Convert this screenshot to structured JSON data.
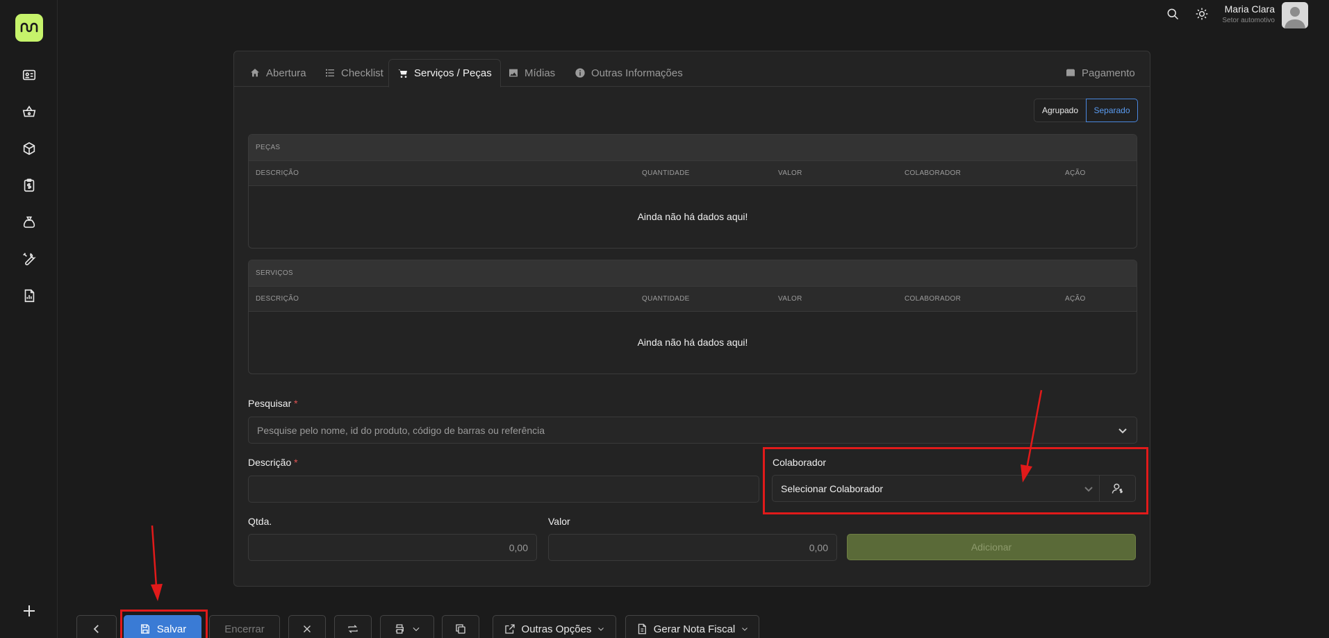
{
  "user": {
    "name": "Maria Clara",
    "role": "Setor automotivo"
  },
  "sidebar": {
    "icons": [
      "id-card-icon",
      "basket-icon",
      "box-icon",
      "clipboard-dollar-icon",
      "money-bag-icon",
      "wrench-icon",
      "report-icon"
    ],
    "add_icon": "plus-icon"
  },
  "tabs": [
    {
      "label": "Abertura",
      "icon": "home-icon"
    },
    {
      "label": "Checklist",
      "icon": "list-icon"
    },
    {
      "label": "Serviços / Peças",
      "icon": "cart-icon",
      "active": true
    },
    {
      "label": "Mídias",
      "icon": "image-icon"
    },
    {
      "label": "Outras Informações",
      "icon": "info-icon"
    }
  ],
  "payment_tab": {
    "label": "Pagamento",
    "icon": "wallet-icon"
  },
  "view_toggle": {
    "grouped": "Agrupado",
    "separated": "Separado",
    "selected": "Separado"
  },
  "parts_table": {
    "title": "PEÇAS",
    "columns": [
      "DESCRIÇÃO",
      "QUANTIDADE",
      "VALOR",
      "COLABORADOR",
      "AÇÃO"
    ],
    "empty_text": "Ainda não há dados aqui!"
  },
  "services_table": {
    "title": "SERVIÇOS",
    "columns": [
      "DESCRIÇÃO",
      "QUANTIDADE",
      "VALOR",
      "COLABORADOR",
      "AÇÃO"
    ],
    "empty_text": "Ainda não há dados aqui!"
  },
  "form": {
    "search_label": "Pesquisar",
    "search_placeholder": "Pesquise pelo nome, id do produto, código de barras ou referência",
    "description_label": "Descrição",
    "description_value": "",
    "collaborator_label": "Colaborador",
    "collaborator_value": "Selecionar Colaborador",
    "qty_label": "Qtda.",
    "qty_value": "0,00",
    "value_label": "Valor",
    "value_value": "0,00",
    "add_button": "Adicionar",
    "required_mark": "*"
  },
  "toolbar": {
    "save": "Salvar",
    "close_order": "Encerrar",
    "other_options": "Outras Opções",
    "invoice": "Gerar Nota Fiscal"
  },
  "colors": {
    "accent": "#c6f36b",
    "primary": "#3a7bd5",
    "highlight": "#e11a1a"
  }
}
